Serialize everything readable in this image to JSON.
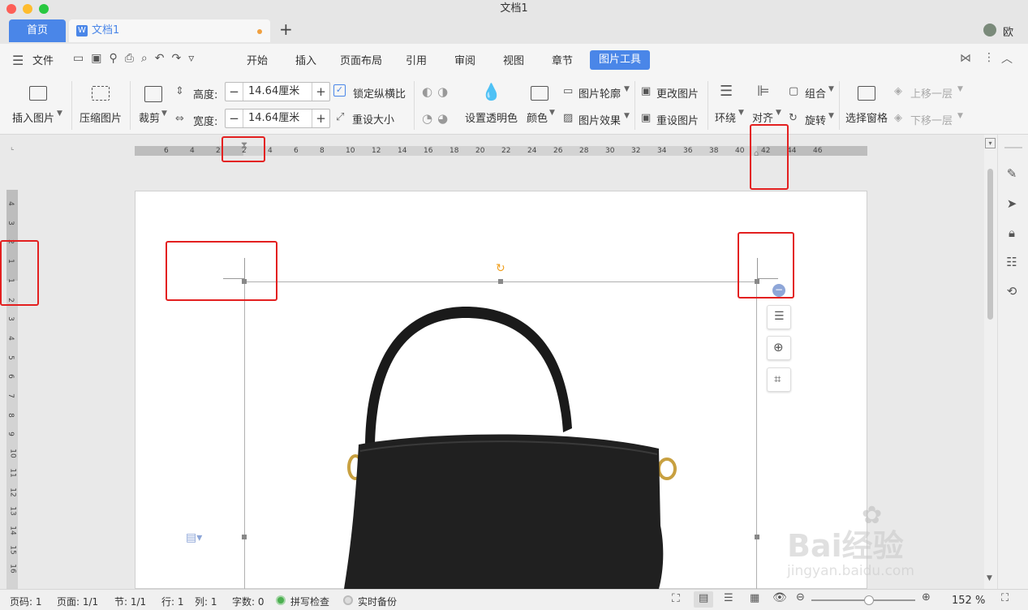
{
  "window": {
    "title": "文档1"
  },
  "tabs": {
    "home": "首页",
    "doc": "文档1",
    "user": "欧"
  },
  "menu": {
    "file": "文件",
    "items": [
      "开始",
      "插入",
      "页面布局",
      "引用",
      "审阅",
      "视图",
      "章节"
    ],
    "active": "图片工具"
  },
  "ribbon": {
    "insert_image": "插入图片",
    "compress": "压缩图片",
    "crop": "裁剪",
    "height_label": "高度:",
    "height_value": "14.64厘米",
    "width_label": "宽度:",
    "width_value": "14.64厘米",
    "lock_ratio": "锁定纵横比",
    "reset_size": "重设大小",
    "set_transparent": "设置透明色",
    "color": "颜色",
    "outline": "图片轮廓",
    "effects": "图片效果",
    "change_image": "更改图片",
    "reset_image": "重设图片",
    "wrap": "环绕",
    "align": "对齐",
    "group": "组合",
    "rotate": "旋转",
    "selection_pane": "选择窗格",
    "bring_forward": "上移一层",
    "send_backward": "下移一层"
  },
  "ruler": {
    "h_labels": [
      "6",
      "4",
      "2",
      "2",
      "4",
      "6",
      "8",
      "10",
      "12",
      "14",
      "16",
      "18",
      "20",
      "22",
      "24",
      "26",
      "28",
      "30",
      "32",
      "34",
      "36",
      "38",
      "40",
      "42",
      "44",
      "46"
    ],
    "v_labels": [
      "4",
      "3",
      "2",
      "1",
      "1",
      "2",
      "3",
      "4",
      "5",
      "6",
      "7",
      "8",
      "9",
      "10",
      "11",
      "12",
      "13",
      "14",
      "15",
      "16"
    ]
  },
  "status": {
    "page_code": "页码: 1",
    "pages": "页面: 1/1",
    "section": "节: 1/1",
    "row": "行: 1",
    "col": "列: 1",
    "words": "字数: 0",
    "spell": "拼写检查",
    "backup": "实时备份",
    "zoom": "152 %"
  },
  "watermark": {
    "text": "Bai经验",
    "url": "jingyan.baidu.com"
  },
  "colors": {
    "accent": "#4a86e8",
    "highlight": "#e32020",
    "bag": "#202020"
  }
}
